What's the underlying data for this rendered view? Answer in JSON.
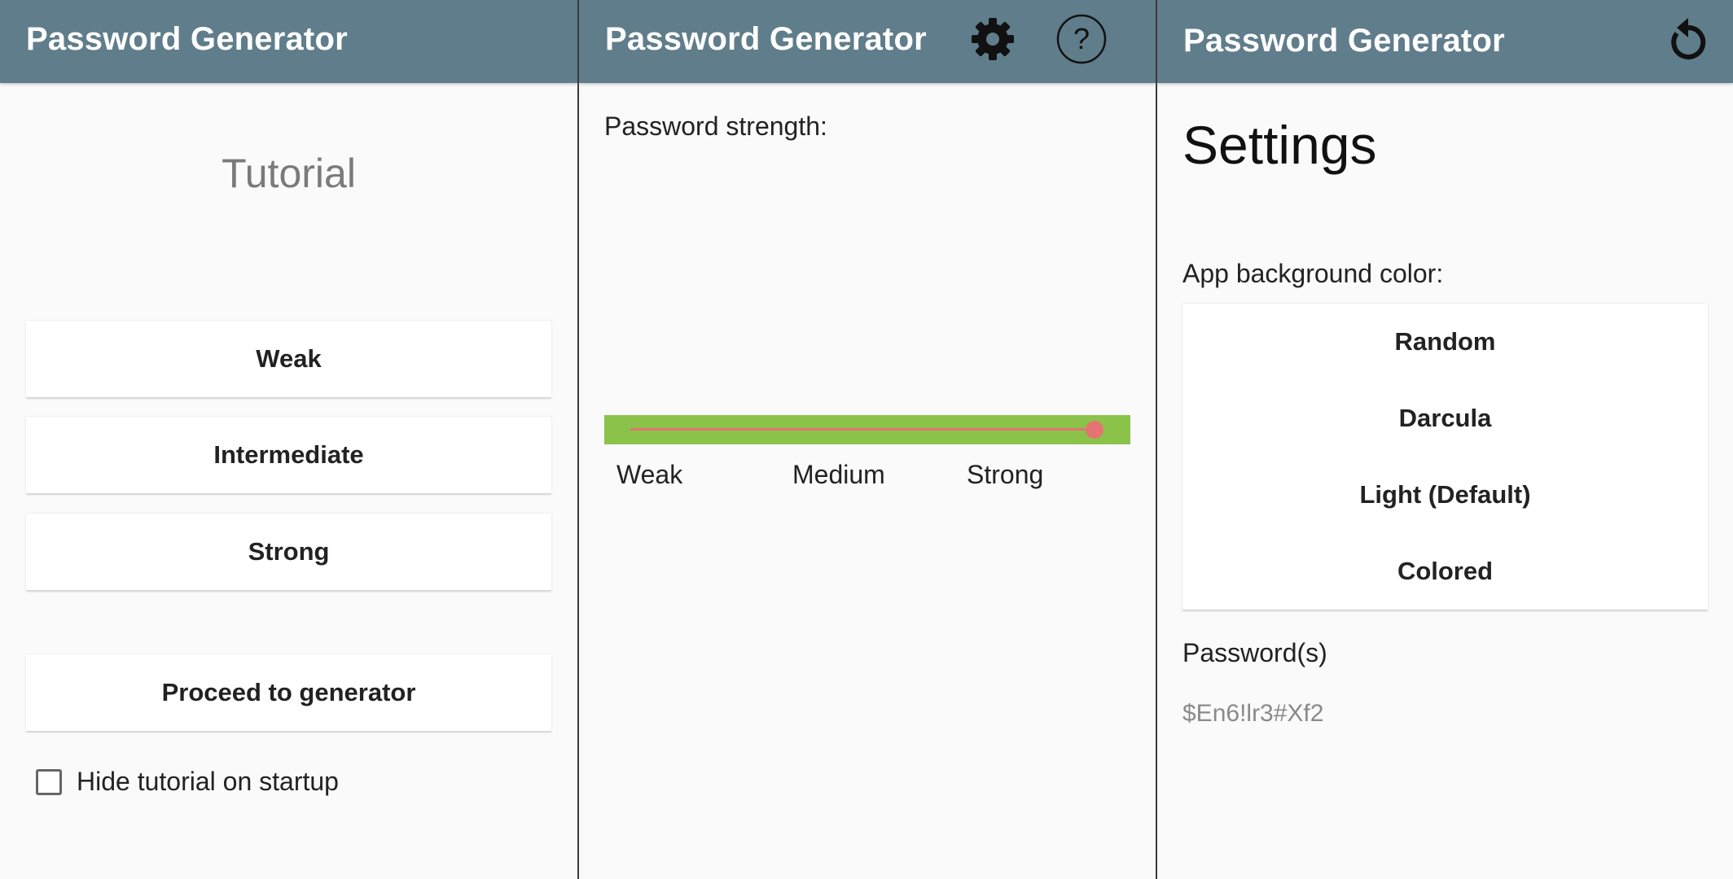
{
  "colors": {
    "appbar": "#607d8b",
    "strength_bar": "#8bc34a",
    "strength_thumb": "#e57373",
    "background": "#fafafa"
  },
  "tutorial_screen": {
    "title": "Password Generator",
    "heading": "Tutorial",
    "buttons": [
      "Weak",
      "Intermediate",
      "Strong"
    ],
    "proceed_label": "Proceed to generator",
    "hide_tutorial": {
      "label": "Hide tutorial on startup",
      "checked": false
    }
  },
  "generator_screen": {
    "title": "Password Generator",
    "icons": [
      "gear-icon",
      "help-icon"
    ],
    "strength_label": "Password strength:",
    "strength_value": 1.0,
    "strength_ticks": [
      "Weak",
      "Medium",
      "Strong"
    ]
  },
  "settings_screen": {
    "title": "Password Generator",
    "icons": [
      "reset-icon"
    ],
    "heading": "Settings",
    "bg_color_label": "App background color:",
    "bg_options": [
      "Random",
      "Darcula",
      "Light (Default)",
      "Colored"
    ],
    "passwords_label": "Password(s)",
    "password_value": "$En6!lr3#Xf2"
  }
}
